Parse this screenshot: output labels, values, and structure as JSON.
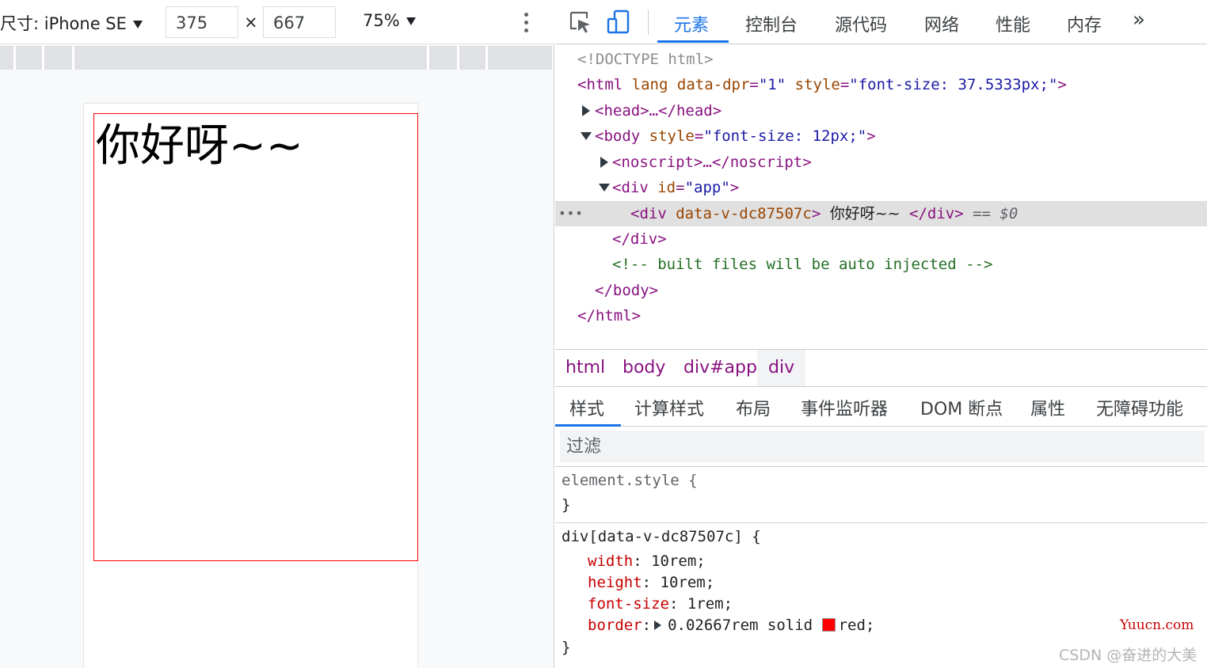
{
  "device_toolbar": {
    "device_label": "尺寸: iPhone SE",
    "width_value": "375",
    "times": "×",
    "height_value": "667",
    "zoom": "75%"
  },
  "page": {
    "hello_text": "你好呀~~"
  },
  "devtools": {
    "tabs": [
      "元素",
      "控制台",
      "源代码",
      "网络",
      "性能",
      "内存"
    ],
    "more": "»",
    "dom": {
      "doctype": "<!DOCTYPE html>",
      "html_open": "<html",
      "html_attr_lang": "lang",
      "html_attr_dpr_name": "data-dpr",
      "html_attr_dpr_value": "\"1\"",
      "html_attr_style_name": "style",
      "html_attr_style_value": "\"font-size: 37.5333px;\"",
      "gt": ">",
      "eq": "=",
      "head": "<head>…</head>",
      "body_open": "<body",
      "body_style_name": "style",
      "body_style_value": "\"font-size: 12px;\"",
      "noscript": "<noscript>…</noscript>",
      "div_app_open": "<div",
      "div_app_attr": "id",
      "div_app_value": "\"app\"",
      "selected_open": "<div",
      "selected_attr": "data-v-dc87507c",
      "selected_text": "你好呀~~",
      "selected_close": "</div>",
      "selected_ref": "== $0",
      "div_close": "</div>",
      "comment": "<!-- built files will be auto injected -->",
      "body_close": "</body>",
      "html_close": "</html>",
      "dots": "•••"
    },
    "breadcrumbs": [
      "html",
      "body",
      "div#app",
      "div"
    ],
    "sub_tabs": [
      "样式",
      "计算样式",
      "布局",
      "事件监听器",
      "DOM 断点",
      "属性",
      "无障碍功能"
    ],
    "filter_placeholder": "过滤",
    "styles": {
      "element_style": "element.style {",
      "close_brace": "}",
      "rule_selector": "div[data-v-dc87507c] {",
      "props": [
        {
          "name": "width",
          "value": "10rem;"
        },
        {
          "name": "height",
          "value": "10rem;"
        },
        {
          "name": "font-size",
          "value": "1rem;"
        },
        {
          "name": "border",
          "value_pre": "0.02667rem solid",
          "value_post": "red;"
        }
      ],
      "colon": ":",
      "swatch_color": "#ff0000"
    }
  },
  "watermarks": {
    "site": "Yuucn.com",
    "author": "CSDN @奋进的大美"
  },
  "colors": {
    "accent": "#1a73e8",
    "tag": "#881280",
    "attr_name": "#994500",
    "attr_value": "#1a1aa6",
    "comment": "#236e25",
    "prop_name": "#c80000",
    "border_red": "#ff0000"
  }
}
